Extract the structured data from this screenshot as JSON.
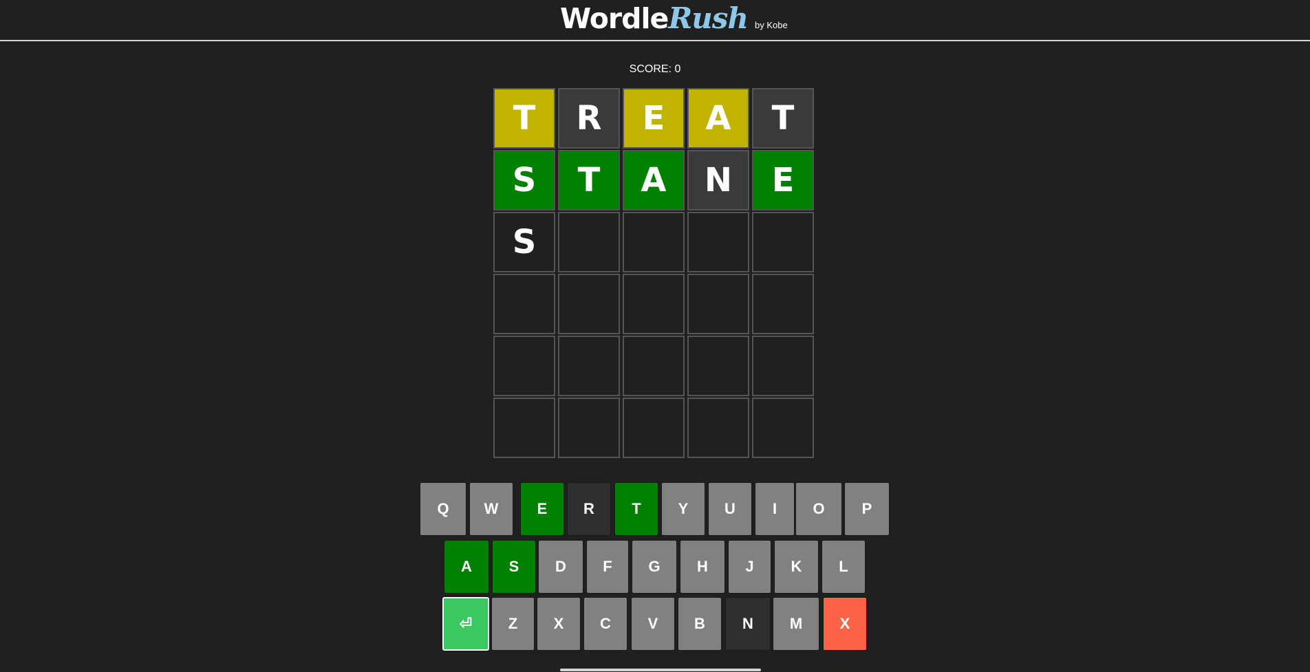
{
  "header": {
    "title_main": "Wordle",
    "title_accent": "Rush",
    "byline": "by Kobe"
  },
  "score": {
    "text": "SCORE: 0"
  },
  "colors": {
    "background": "#202020",
    "correct": "#008000",
    "present": "#c1b400",
    "absent": "#3a3a3a",
    "empty": "#202020",
    "key_default": "#818181",
    "key_correct": "#008000",
    "key_absent": "#2f2f2f",
    "enter_key": "#3cc860",
    "delete_key": "#ff6347",
    "accent_rush": "#8ec8e8"
  },
  "board": {
    "rows": [
      [
        {
          "letter": "T",
          "state": "present"
        },
        {
          "letter": "R",
          "state": "absent"
        },
        {
          "letter": "E",
          "state": "present"
        },
        {
          "letter": "A",
          "state": "present"
        },
        {
          "letter": "T",
          "state": "absent"
        }
      ],
      [
        {
          "letter": "S",
          "state": "correct"
        },
        {
          "letter": "T",
          "state": "correct"
        },
        {
          "letter": "A",
          "state": "correct"
        },
        {
          "letter": "N",
          "state": "absent"
        },
        {
          "letter": "E",
          "state": "correct"
        }
      ],
      [
        {
          "letter": "S",
          "state": "empty"
        },
        {
          "letter": "",
          "state": "empty"
        },
        {
          "letter": "",
          "state": "empty"
        },
        {
          "letter": "",
          "state": "empty"
        },
        {
          "letter": "",
          "state": "empty"
        }
      ],
      [
        {
          "letter": "",
          "state": "empty"
        },
        {
          "letter": "",
          "state": "empty"
        },
        {
          "letter": "",
          "state": "empty"
        },
        {
          "letter": "",
          "state": "empty"
        },
        {
          "letter": "",
          "state": "empty"
        }
      ],
      [
        {
          "letter": "",
          "state": "empty"
        },
        {
          "letter": "",
          "state": "empty"
        },
        {
          "letter": "",
          "state": "empty"
        },
        {
          "letter": "",
          "state": "empty"
        },
        {
          "letter": "",
          "state": "empty"
        }
      ],
      [
        {
          "letter": "",
          "state": "empty"
        },
        {
          "letter": "",
          "state": "empty"
        },
        {
          "letter": "",
          "state": "empty"
        },
        {
          "letter": "",
          "state": "empty"
        },
        {
          "letter": "",
          "state": "empty"
        }
      ]
    ]
  },
  "keyboard": {
    "rows": [
      [
        {
          "label": "Q",
          "state": "default"
        },
        {
          "label": "W",
          "state": "default"
        },
        {
          "label": "E",
          "state": "correct"
        },
        {
          "label": "R",
          "state": "absent"
        },
        {
          "label": "T",
          "state": "correct"
        },
        {
          "label": "Y",
          "state": "default"
        },
        {
          "label": "U",
          "state": "default"
        },
        {
          "label": "I",
          "state": "default"
        },
        {
          "label": "O",
          "state": "default"
        },
        {
          "label": "P",
          "state": "default"
        }
      ],
      [
        {
          "label": "A",
          "state": "correct"
        },
        {
          "label": "S",
          "state": "correct"
        },
        {
          "label": "D",
          "state": "default"
        },
        {
          "label": "F",
          "state": "default"
        },
        {
          "label": "G",
          "state": "default"
        },
        {
          "label": "H",
          "state": "default"
        },
        {
          "label": "J",
          "state": "default"
        },
        {
          "label": "K",
          "state": "default"
        },
        {
          "label": "L",
          "state": "default"
        }
      ],
      [
        {
          "label": "⏎",
          "state": "enter",
          "icon": "enter-icon"
        },
        {
          "label": "Z",
          "state": "default"
        },
        {
          "label": "X",
          "state": "default"
        },
        {
          "label": "C",
          "state": "default"
        },
        {
          "label": "V",
          "state": "default"
        },
        {
          "label": "B",
          "state": "default"
        },
        {
          "label": "N",
          "state": "absent"
        },
        {
          "label": "M",
          "state": "default"
        },
        {
          "label": "X",
          "state": "delete",
          "icon": "delete-icon"
        }
      ]
    ]
  }
}
